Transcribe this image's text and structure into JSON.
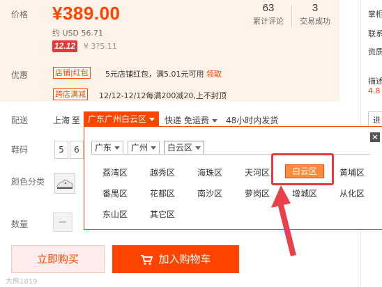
{
  "price": {
    "label": "价格",
    "amount": "¥389.00",
    "usd": "约 USD 56.71",
    "event_badge": "12.12",
    "event_price": "¥ 3?5.11"
  },
  "stats": {
    "reviews": {
      "value": "63",
      "label": "累计评论"
    },
    "sales": {
      "value": "3",
      "label": "交易成功"
    }
  },
  "promo": {
    "label": "优惠",
    "tag1": "店铺|红包",
    "text1": "5元店铺红包，满5.01元可用",
    "text1_link": "领取",
    "tag2": "跨店满减",
    "text2": "12/12-12/12每满200减20,上不封顶"
  },
  "shipping": {
    "label": "配送",
    "from": "上海",
    "to_word": "至",
    "destination": "广东广州白云区",
    "method": "快递 免运费",
    "dispatch": "48小时内发货"
  },
  "size": {
    "label": "鞋码",
    "options": [
      "5",
      "6"
    ]
  },
  "color": {
    "label": "颜色分类"
  },
  "quantity": {
    "label": "数量",
    "minus": "−"
  },
  "region_popup": {
    "close": "×",
    "levels": [
      "广东",
      "广州",
      "白云区"
    ],
    "districts": [
      "荔湾区",
      "越秀区",
      "海珠区",
      "天河区",
      "白云区",
      "黄埔区",
      "番禺区",
      "花都区",
      "南沙区",
      "萝岗区",
      "增城区",
      "从化区",
      "东山区",
      "其它区"
    ],
    "selected": "白云区"
  },
  "actions": {
    "buy_now": "立即购买",
    "add_to_cart": "加入购物车"
  },
  "right_column": {
    "item1": "掌柜",
    "item2": "联系",
    "item3": "资质",
    "item4": "描述",
    "item5": "4.8",
    "item6": "进"
  },
  "watermark": "大熊1819",
  "colors": {
    "accent": "#ff4400",
    "highlight": "#e23b3b",
    "panel_bg": "#fff2e8"
  }
}
